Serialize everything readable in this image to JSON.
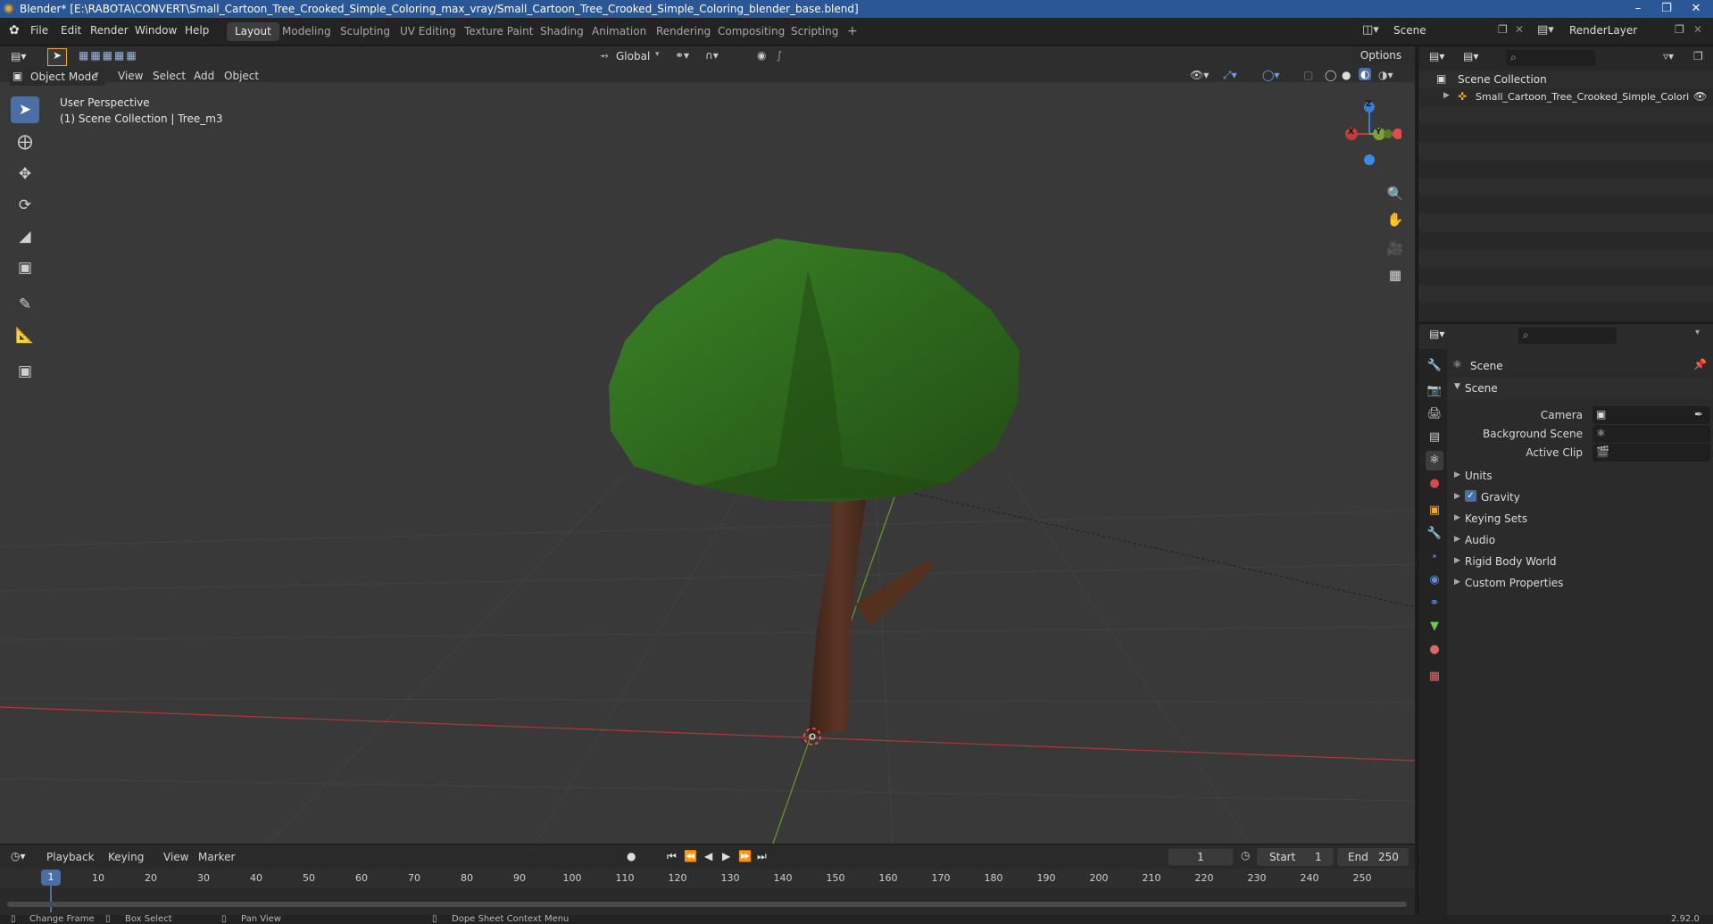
{
  "window": {
    "title": "Blender* [E:\\RABOTA\\CONVERT\\Small_Cartoon_Tree_Crooked_Simple_Coloring_max_vray/Small_Cartoon_Tree_Crooked_Simple_Coloring_blender_base.blend]",
    "minimize": "–",
    "maximize": "❐",
    "close": "✕"
  },
  "menu": [
    "File",
    "Edit",
    "Render",
    "Window",
    "Help"
  ],
  "workspaces": [
    "Layout",
    "Modeling",
    "Sculpting",
    "UV Editing",
    "Texture Paint",
    "Shading",
    "Animation",
    "Rendering",
    "Compositing",
    "Scripting"
  ],
  "add_workspace": "+",
  "scene_field": "Scene",
  "render_layer_field": "RenderLayer",
  "header": {
    "transform_orientation": "Global",
    "options": "Options"
  },
  "viewport": {
    "mode": "Object Mode",
    "menus": [
      "View",
      "Select",
      "Add",
      "Object"
    ],
    "perspective_label": "User Perspective",
    "collection_label": "(1) Scene Collection | Tree_m3",
    "gizmo": {
      "z": "Z",
      "y": "Y",
      "x": "X"
    }
  },
  "outliner": {
    "root": "Scene Collection",
    "object": "Small_Cartoon_Tree_Crooked_Simple_Colori"
  },
  "properties": {
    "context": "Scene",
    "panel_title": "Scene",
    "fields": [
      {
        "label": "Camera",
        "value": ""
      },
      {
        "label": "Background Scene",
        "value": ""
      },
      {
        "label": "Active Clip",
        "value": ""
      }
    ],
    "sections": [
      "Units",
      "Gravity",
      "Keying Sets",
      "Audio",
      "Rigid Body World",
      "Custom Properties"
    ],
    "gravity_checked": true
  },
  "timeline": {
    "menus": [
      "Playback",
      "Keying",
      "View",
      "Marker"
    ],
    "current_frame": "1",
    "start_label": "Start",
    "start": "1",
    "end_label": "End",
    "end": "250",
    "ticks": [
      "10",
      "20",
      "30",
      "40",
      "50",
      "60",
      "70",
      "80",
      "90",
      "100",
      "110",
      "120",
      "130",
      "140",
      "150",
      "160",
      "170",
      "180",
      "190",
      "200",
      "210",
      "220",
      "230",
      "240",
      "250"
    ],
    "playhead": "1"
  },
  "status": {
    "items": [
      "Change Frame",
      "Box Select",
      "Pan View",
      "Dope Sheet Context Menu"
    ],
    "version": "2.92.0"
  },
  "colors": {
    "accent": "#4a6fa5",
    "axis_x": "#c23b3b",
    "axis_y": "#7ea23a",
    "axis_z": "#3a7ad9",
    "foliage": "#2e6b1e",
    "trunk": "#4a2c1f"
  }
}
